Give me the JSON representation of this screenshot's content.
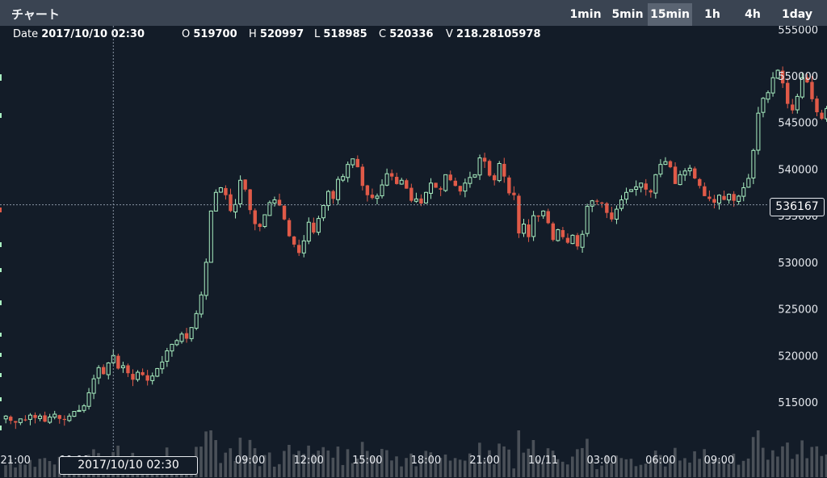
{
  "app": {
    "title": "チャート"
  },
  "timeframes": [
    {
      "label": "1min",
      "active": false
    },
    {
      "label": "5min",
      "active": false
    },
    {
      "label": "15min",
      "active": true
    },
    {
      "label": "1h",
      "active": false
    },
    {
      "label": "4h",
      "active": false
    },
    {
      "label": "1day",
      "active": false
    }
  ],
  "ohlc": {
    "date_label": "Date",
    "date": "2017/10/10 02:30",
    "open_label": "O",
    "open": "519700",
    "high_label": "H",
    "high": "520997",
    "low_label": "L",
    "low": "518985",
    "close_label": "C",
    "close": "520336",
    "volume_label": "V",
    "volume": "218.28105978"
  },
  "crosshair": {
    "time": "2017/10/10 02:30",
    "price": "536167"
  },
  "colors": {
    "up": "#a8eec0",
    "down": "#e05a48",
    "background": "#131c28",
    "topbar": "#3a4452",
    "volume": "#4a5058",
    "crosshair": "#8893a2"
  },
  "chart_data": {
    "type": "candlestick",
    "interval": "15min",
    "ylim": [
      510000,
      556000
    ],
    "y_ticks": [
      515000,
      520000,
      525000,
      530000,
      535000,
      540000,
      545000,
      550000,
      555000
    ],
    "y_tick_labels": [
      "515000",
      "520000",
      "525000",
      "530000",
      "535000",
      "540000",
      "545000",
      "550000",
      "555000"
    ],
    "x_tick_labels": [
      "21:00",
      "00:00",
      "09:00",
      "12:00",
      "15:00",
      "18:00",
      "21:00",
      "10/11",
      "03:00",
      "06:00",
      "09:00"
    ],
    "x_tick_positions": [
      0,
      12,
      48,
      60,
      72,
      84,
      96,
      108,
      120,
      132,
      144
    ],
    "crosshair_index": 22,
    "crosshair_price": 536167,
    "closes": [
      513500,
      513000,
      512800,
      513200,
      513100,
      513600,
      513300,
      513500,
      512900,
      513400,
      513700,
      513200,
      513100,
      513500,
      514000,
      514100,
      514600,
      516000,
      517500,
      518700,
      518000,
      519200,
      520000,
      518600,
      518900,
      518100,
      517400,
      518200,
      517900,
      517300,
      517800,
      518600,
      519300,
      520500,
      521200,
      521600,
      522300,
      521800,
      523000,
      524500,
      526500,
      530000,
      535500,
      537500,
      538000,
      537200,
      535500,
      536200,
      538800,
      537800,
      535600,
      534100,
      533800,
      535100,
      536400,
      536700,
      536100,
      534600,
      532800,
      531900,
      531000,
      532300,
      534300,
      533200,
      534700,
      536100,
      537600,
      536800,
      538900,
      539200,
      540500,
      541100,
      540200,
      538200,
      537200,
      536900,
      537100,
      538300,
      539500,
      539200,
      538400,
      538800,
      537900,
      536600,
      536800,
      536300,
      537500,
      538500,
      538000,
      537800,
      539400,
      538800,
      538200,
      537600,
      538500,
      539100,
      539400,
      541200,
      540800,
      539300,
      538800,
      540600,
      539200,
      537400,
      537200,
      533100,
      534100,
      532700,
      535000,
      534900,
      535500,
      534200,
      532400,
      533500,
      532700,
      532100,
      532900,
      531700,
      533000,
      536000,
      536600,
      536500,
      536300,
      535300,
      534600,
      535700,
      536700,
      537500,
      537800,
      538100,
      538500,
      537800,
      537500,
      539400,
      540500,
      540800,
      540200,
      538400,
      539400,
      539800,
      540100,
      539000,
      538200,
      537100,
      536800,
      536400,
      537200,
      536700,
      537300,
      536600,
      537100,
      538000,
      539000,
      542000,
      546000,
      547600,
      548200,
      549800,
      550600,
      549200,
      547000,
      546300,
      547800,
      549800,
      549300,
      547500,
      546100,
      545400,
      546500,
      545600,
      546500,
      547900,
      549500,
      549200,
      548600,
      549300,
      547300,
      547800,
      547200,
      546600,
      545600,
      543700,
      542300,
      542700,
      541300,
      538100,
      537700,
      536400,
      534900,
      536700,
      535200,
      533100,
      534700,
      536100,
      534700,
      532700,
      531200
    ]
  }
}
